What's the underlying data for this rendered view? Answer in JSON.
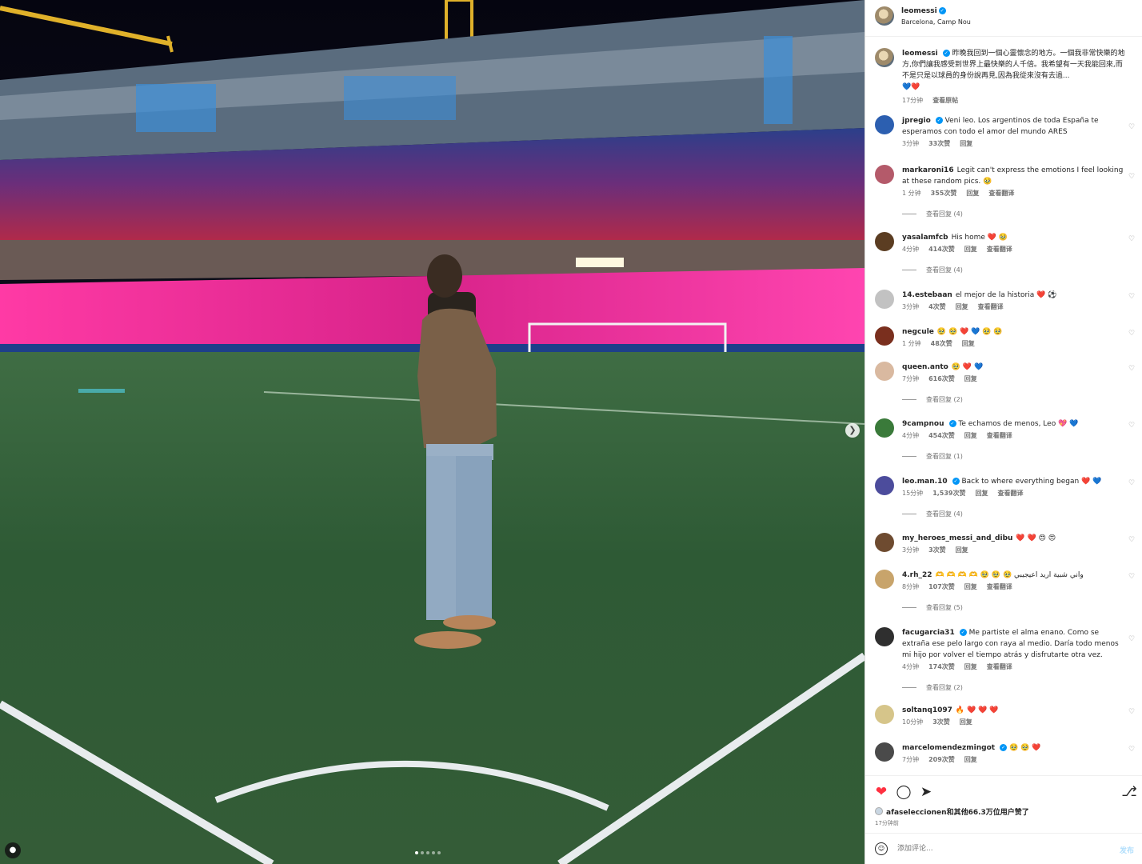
{
  "header": {
    "username": "leomessi",
    "location": "Barcelona, Camp Nou"
  },
  "caption": {
    "username": "leomessi",
    "text": "昨晚我回到一個心靈懷念的地方。一個我非常快樂的地方,你們讓我感受到世界上最快樂的人千倍。我希望有一天我能回來,而不是只是以球員的身份說再見,因為我從來沒有去過...",
    "emoji": "💙❤️",
    "time": "17分钟",
    "see_translation": "查看原帖"
  },
  "comments": [
    {
      "username": "jpregio",
      "verified": true,
      "text": "Veni leo. Los argentinos de toda España te esperamos con todo el amor del mundo ARES",
      "time": "3分钟",
      "likes": "33次赞",
      "reply": "回复",
      "translate": "",
      "replies": ""
    },
    {
      "username": "markaroni16",
      "verified": false,
      "text": "Legit can't express the emotions I feel looking at these random pics. 🥹",
      "time": "1 分钟",
      "likes": "355次赞",
      "reply": "回复",
      "translate": "查看翻译",
      "replies": "查看回复 (4)"
    },
    {
      "username": "yasalamfcb",
      "verified": false,
      "text": "His home ❤️ 🥹",
      "time": "4分钟",
      "likes": "414次赞",
      "reply": "回复",
      "translate": "查看翻译",
      "replies": "查看回复 (4)"
    },
    {
      "username": "14.estebaan",
      "verified": false,
      "text": "el mejor de la historia ❤️ ⚽",
      "time": "3分钟",
      "likes": "4次赞",
      "reply": "回复",
      "translate": "查看翻译",
      "replies": ""
    },
    {
      "username": "negcule",
      "verified": false,
      "text": "🥹 🥹 ❤️ 💙 🥹 🥹",
      "time": "1 分钟",
      "likes": "48次赞",
      "reply": "回复",
      "translate": "",
      "replies": ""
    },
    {
      "username": "queen.anto",
      "verified": false,
      "text": "🥹 ❤️ 💙",
      "time": "7分钟",
      "likes": "616次赞",
      "reply": "回复",
      "translate": "",
      "replies": "查看回复 (2)"
    },
    {
      "username": "9campnou",
      "verified": true,
      "text": "Te echamos de menos, Leo 💖 💙",
      "time": "4分钟",
      "likes": "454次赞",
      "reply": "回复",
      "translate": "查看翻译",
      "replies": "查看回复 (1)"
    },
    {
      "username": "leo.man.10",
      "verified": true,
      "text": "Back to where everything began ❤️ 💙",
      "time": "15分钟",
      "likes": "1,539次赞",
      "reply": "回复",
      "translate": "查看翻译",
      "replies": "查看回复 (4)"
    },
    {
      "username": "my_heroes_messi_and_dibu",
      "verified": false,
      "text": "❤️ ❤️ 😍 😍",
      "time": "3分钟",
      "likes": "3次赞",
      "reply": "回复",
      "translate": "",
      "replies": ""
    },
    {
      "username": "4.rh_22",
      "verified": false,
      "text": "🫶 🫶 🫶 🫶 🥹 🥹 🥹 واني شبية اريد اعيجيبي",
      "time": "8分钟",
      "likes": "107次赞",
      "reply": "回复",
      "translate": "查看翻译",
      "replies": "查看回复 (5)"
    },
    {
      "username": "facugarcia31",
      "verified": true,
      "text": "Me partiste el alma enano. Como se extraña ese pelo largo con raya al medio. Daría todo menos mi hijo por volver el tiempo atrás y disfrutarte otra vez.",
      "time": "4分钟",
      "likes": "174次赞",
      "reply": "回复",
      "translate": "查看翻译",
      "replies": "查看回复 (2)"
    },
    {
      "username": "soltanq1097",
      "verified": false,
      "text": "🔥 ❤️ ❤️ ❤️",
      "time": "10分钟",
      "likes": "3次赞",
      "reply": "回复",
      "translate": "",
      "replies": ""
    },
    {
      "username": "marcelomendezmingot",
      "verified": true,
      "text": "🥹 🥹 ❤️",
      "time": "7分钟",
      "likes": "209次赞",
      "reply": "回复",
      "translate": "",
      "replies": ""
    }
  ],
  "likes_line": {
    "user": "afaseleccionen",
    "rest": "和其他66.3万位用户赞了"
  },
  "posted": "17分钟前",
  "add_comment": {
    "placeholder": "添加评论...",
    "post_label": "发布"
  },
  "icons": {
    "like": "heart-icon",
    "comment": "comment-icon",
    "share": "share-icon",
    "save": "bookmark-icon",
    "emoji": "emoji-icon",
    "next": "chevron-right-icon",
    "tag": "user-tag-icon"
  },
  "colors": {
    "like_red": "#ff3040",
    "verified_blue": "#0095f6",
    "post_button": "#b2dffc"
  }
}
